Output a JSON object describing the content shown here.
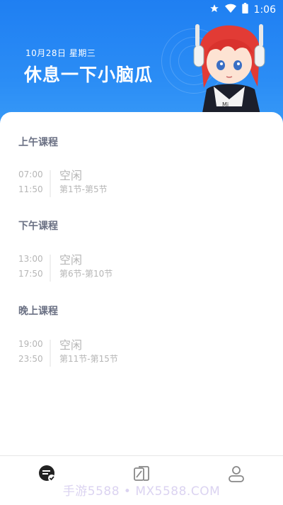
{
  "status_bar": {
    "time": "1:06",
    "icons": [
      "star-icon",
      "wifi-icon",
      "battery-icon"
    ]
  },
  "header": {
    "date": "10月28日 星期三",
    "greeting": "休息一下小脑瓜",
    "mascot_text": "Mi"
  },
  "schedule": {
    "sections": [
      {
        "title": "上午课程",
        "slot": {
          "start": "07:00",
          "end": "11:50",
          "status": "空闲",
          "periods": "第1节-第5节"
        }
      },
      {
        "title": "下午课程",
        "slot": {
          "start": "13:00",
          "end": "17:50",
          "status": "空闲",
          "periods": "第6节-第10节"
        }
      },
      {
        "title": "晚上课程",
        "slot": {
          "start": "19:00",
          "end": "23:50",
          "status": "空闲",
          "periods": "第11节-第15节"
        }
      }
    ]
  },
  "tabbar": {
    "tabs": [
      {
        "icon": "schedule-check-icon",
        "active": true
      },
      {
        "icon": "books-icon",
        "active": false
      },
      {
        "icon": "user-icon",
        "active": false
      }
    ]
  },
  "watermark": "手游5588 • MX5588.COM",
  "colors": {
    "header_blue": "#1f7ff2",
    "title_gray": "#6b7184",
    "muted_gray": "#b6b6b6",
    "active_icon": "#222222"
  }
}
